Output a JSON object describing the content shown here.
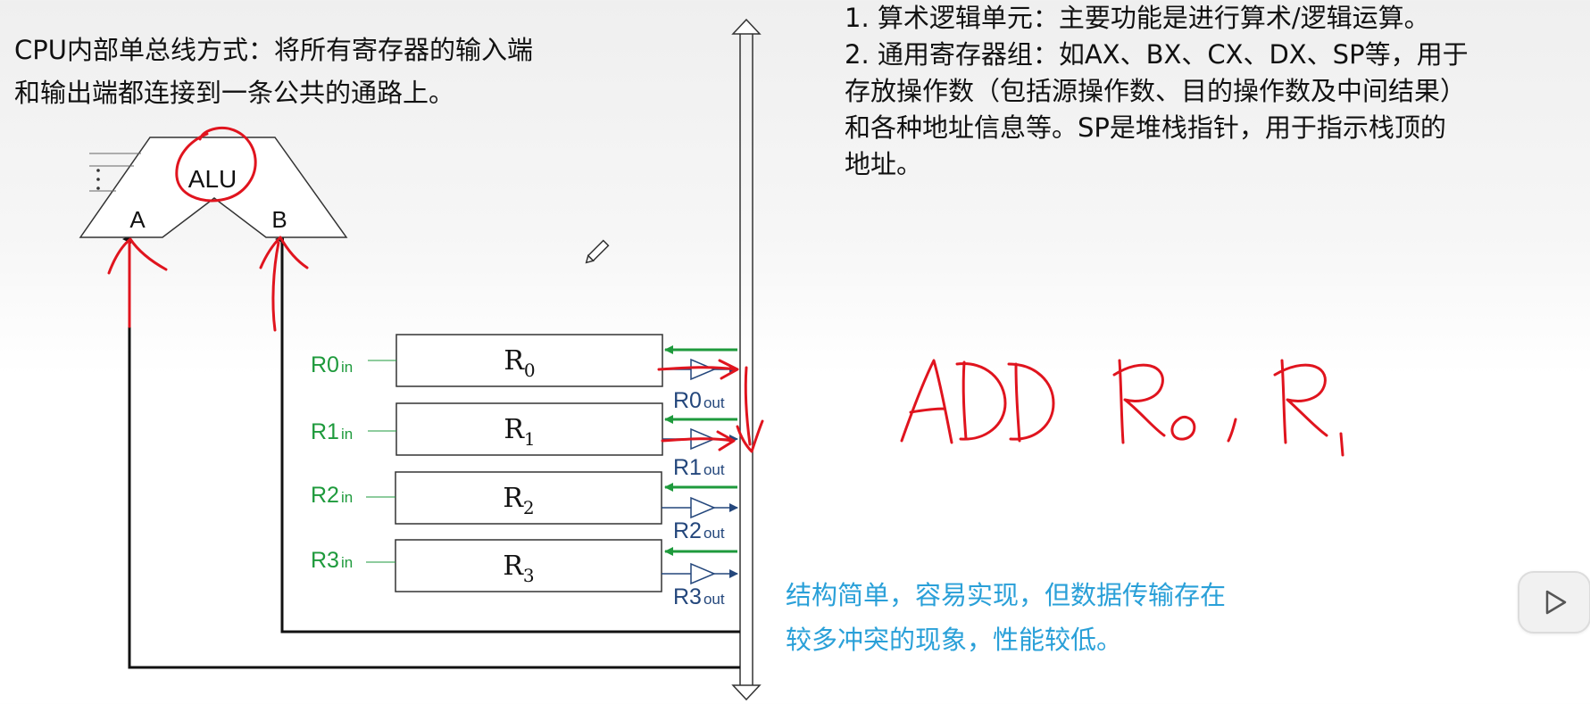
{
  "intro": {
    "line1": "CPU内部单总线方式：将所有寄存器的输入端",
    "line2": "和输出端都连接到一条公共的通路上。"
  },
  "description": {
    "line1": "1. 算术逻辑单元：主要功能是进行算术/逻辑运算。",
    "line2": "2. 通用寄存器组：如AX、BX、CX、DX、SP等，用于",
    "line3": "存放操作数（包括源操作数、目的操作数及中间结果）",
    "line4": "和各种地址信息等。SP是堆栈指针，用于指示栈顶的",
    "line5": "地址。"
  },
  "summary": {
    "line1": "结构简单，容易实现，但数据传输存在",
    "line2": "较多冲突的现象，性能较低。"
  },
  "alu": {
    "label": "ALU",
    "port_a": "A",
    "port_b": "B"
  },
  "registers": [
    {
      "name": "R",
      "sub": "0",
      "in_main": "R0",
      "in_sub": "in",
      "out_main": "R0",
      "out_sub": "out"
    },
    {
      "name": "R",
      "sub": "1",
      "in_main": "R1",
      "in_sub": "in",
      "out_main": "R1",
      "out_sub": "out"
    },
    {
      "name": "R",
      "sub": "2",
      "in_main": "R2",
      "in_sub": "in",
      "out_main": "R2",
      "out_sub": "out"
    },
    {
      "name": "R",
      "sub": "3",
      "in_main": "R3",
      "in_sub": "in",
      "out_main": "R3",
      "out_sub": "out"
    }
  ],
  "colors": {
    "input_control": "#1e9a3c",
    "output_control": "#24477c",
    "annotation_ink": "#e0141e",
    "summary_text": "#2aa0d8"
  },
  "icons": [
    "pencil-cursor-icon",
    "play-icon",
    "ellipsis-vertical-icon"
  ]
}
